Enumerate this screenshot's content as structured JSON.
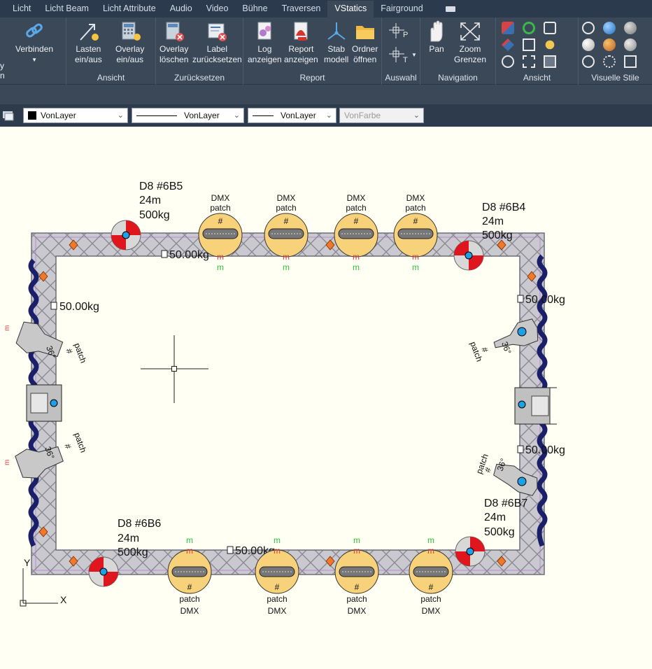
{
  "tabs": [
    "Licht",
    "Licht Beam",
    "Licht Attribute",
    "Audio",
    "Video",
    "Bühne",
    "Traversen",
    "VStatics",
    "Fairground"
  ],
  "active_tab": "VStatics",
  "ribbon": {
    "verbinden": "Verbinden",
    "lasten": "Lasten\nein/aus",
    "overlay": "Overlay\nein/aus",
    "overlay_loeschen": "Overlay\nlöschen",
    "label_zuruecksetzen": "Label\nzurücksetzen",
    "log": "Log\nanzeigen",
    "report": "Report\nanzeigen",
    "stab": "Stab\nmodell",
    "ordner": "Ordner\nöffnen",
    "pan": "Pan",
    "zoom": "Zoom\nGrenzen",
    "panel_ansicht": "Ansicht",
    "panel_zuruecksetzen": "Zurücksetzen",
    "panel_report": "Report",
    "panel_auswahl": "Auswahl",
    "panel_navigation": "Navigation",
    "panel_ansicht2": "Ansicht",
    "panel_visuelle": "Visuelle Stile"
  },
  "properties": {
    "color": "VonLayer",
    "linetype": "VonLayer",
    "lineweight": "VonLayer",
    "plotstyle": "VonFarbe"
  },
  "drawing": {
    "hoists": [
      {
        "name": "D8  #6B5",
        "length": "24m",
        "load": "500kg"
      },
      {
        "name": "D8  #6B4",
        "length": "24m",
        "load": "500kg"
      },
      {
        "name": "D8  #6B6",
        "length": "24m",
        "load": "500kg"
      },
      {
        "name": "D8  #6B7",
        "length": "24m",
        "load": "500kg"
      }
    ],
    "loads": [
      "50.00kg",
      "50.00kg",
      "50.00kg",
      "50.00kg",
      "50.00kg"
    ],
    "fixture_label_top": "DMX",
    "fixture_label_bottom": "patch",
    "fixture_hash": "#",
    "fixture_m": "m",
    "spot_angle": "36°",
    "ucs_x": "X",
    "ucs_y": "Y"
  }
}
